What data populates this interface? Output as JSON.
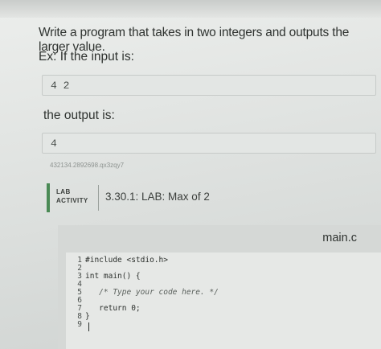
{
  "prompt": {
    "text": "Write a program that takes in two integers and outputs the larger value.",
    "example_intro": "Ex: If the input is:",
    "input_value": "4 2",
    "output_intro": "the output is:",
    "output_value": "4",
    "reference_id": "432134.2892698.qx3zqy7"
  },
  "lab": {
    "label_line1": "LAB",
    "label_line2": "ACTIVITY",
    "title": "3.30.1: LAB: Max of 2",
    "accent_color": "#4a8a55"
  },
  "editor": {
    "filename": "main.c",
    "lines": [
      {
        "no": "1",
        "code": "#include <stdio.h>"
      },
      {
        "no": "2",
        "code": ""
      },
      {
        "no": "3",
        "code": "int main() {"
      },
      {
        "no": "4",
        "code": ""
      },
      {
        "no": "5",
        "code": "   /* Type your code here. */"
      },
      {
        "no": "6",
        "code": ""
      },
      {
        "no": "7",
        "code": "   return 0;"
      },
      {
        "no": "8",
        "code": "}"
      },
      {
        "no": "9",
        "code": ""
      }
    ]
  }
}
